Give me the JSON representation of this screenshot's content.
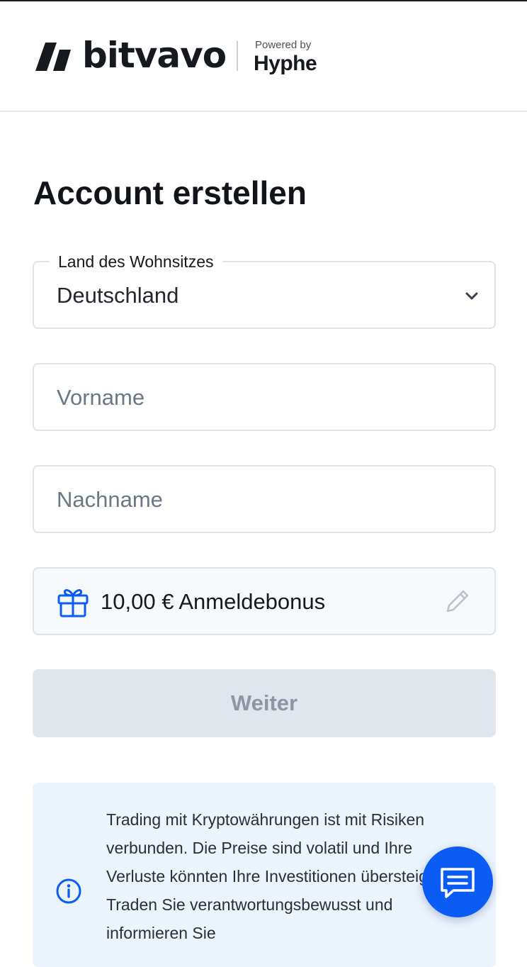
{
  "header": {
    "brand": "bitvavo",
    "powered_by": "Powered by",
    "partner": "Hyphe"
  },
  "page": {
    "title": "Account erstellen"
  },
  "form": {
    "country": {
      "label": "Land des Wohnsitzes",
      "value": "Deutschland"
    },
    "first_name": {
      "placeholder": "Vorname"
    },
    "last_name": {
      "placeholder": "Nachname"
    },
    "bonus": {
      "text": "10,00 € Anmeldebonus"
    },
    "submit_label": "Weiter"
  },
  "info": {
    "text": "Trading mit Kryptowährungen ist mit Risiken verbunden. Die Preise sind volatil und Ihre Verluste könnten Ihre Investitionen übersteigen. Traden Sie verantwortungsbewusst und informieren Sie"
  },
  "icons": {
    "logo": "bitvavo-logo-icon",
    "select": "chevron-down-icon",
    "gift": "gift-icon",
    "edit": "pencil-icon",
    "info": "info-icon",
    "chat": "chat-icon"
  },
  "colors": {
    "accent": "#0a5cf5",
    "button_disabled_bg": "#e1e6ed",
    "button_disabled_text": "#8d97a3",
    "info_bg": "#ebf3fc"
  }
}
